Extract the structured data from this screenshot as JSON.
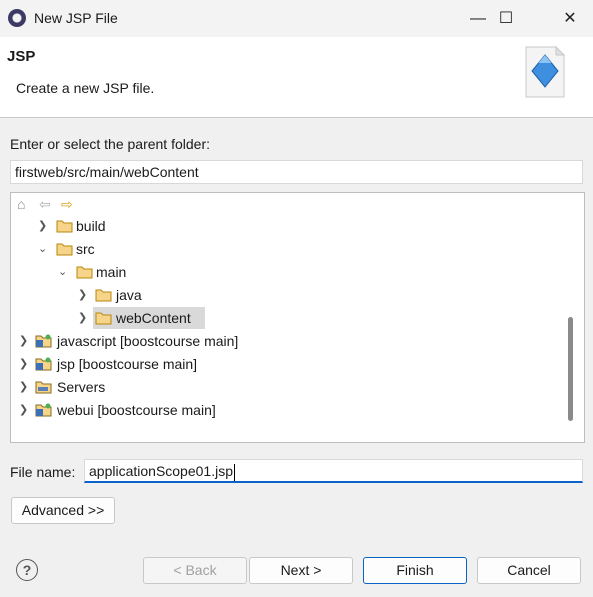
{
  "window": {
    "title": "New JSP File",
    "minimize": "—",
    "maximize": "☐",
    "close": "✕"
  },
  "header": {
    "title": "JSP",
    "subtitle": "Create a new JSP file."
  },
  "folder": {
    "label": "Enter or select the parent folder:",
    "value": "firstweb/src/main/webContent"
  },
  "tree": {
    "items": [
      {
        "label": "build",
        "expanded": false,
        "icon": "folder-icon"
      },
      {
        "label": "src",
        "expanded": true,
        "icon": "folder-icon"
      },
      {
        "label": "main",
        "expanded": true,
        "icon": "folder-icon"
      },
      {
        "label": "java",
        "expanded": false,
        "icon": "folder-icon"
      },
      {
        "label": "webContent",
        "expanded": false,
        "icon": "folder-icon",
        "selected": true
      },
      {
        "label": "javascript [boostcourse main]",
        "expanded": false,
        "icon": "project-icon"
      },
      {
        "label": "jsp [boostcourse main]",
        "expanded": false,
        "icon": "project-icon"
      },
      {
        "label": "Servers",
        "expanded": false,
        "icon": "folder-icon"
      },
      {
        "label": "webui [boostcourse main]",
        "expanded": false,
        "icon": "project-icon"
      }
    ]
  },
  "filename": {
    "label": "File name:",
    "value": "applicationScope01.jsp"
  },
  "buttons": {
    "advanced": "Advanced >>",
    "back": "< Back",
    "next": "Next >",
    "finish": "Finish",
    "cancel": "Cancel",
    "help": "?"
  },
  "colors": {
    "accent": "#0a63c8",
    "folder": "#e8b84a",
    "selection": "#d9d9d9"
  }
}
